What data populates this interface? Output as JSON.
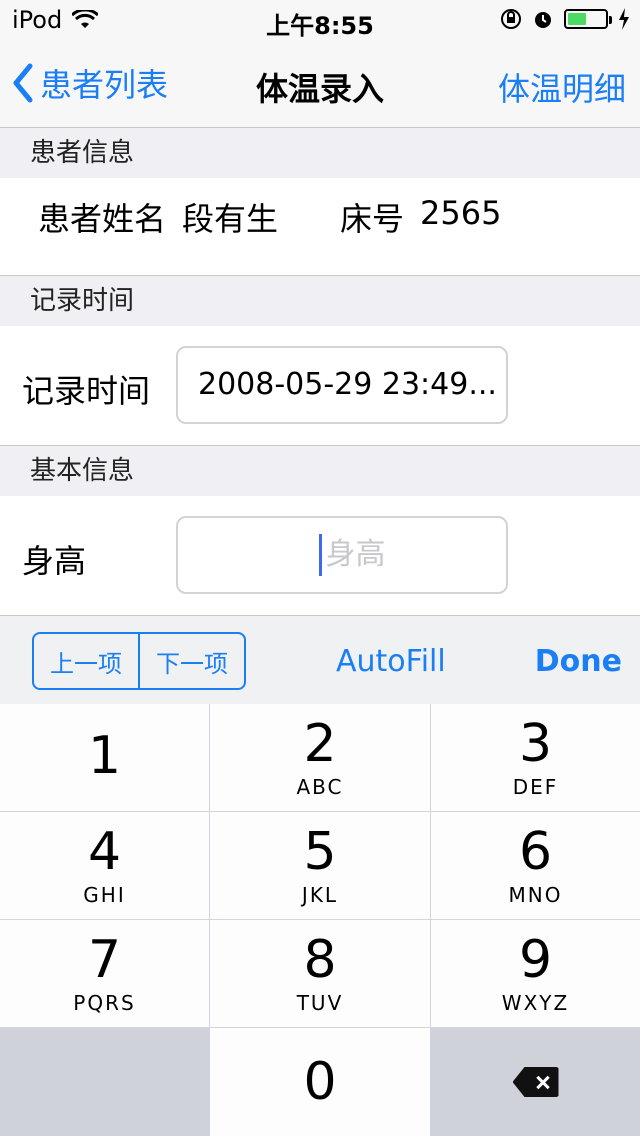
{
  "status_bar": {
    "device": "iPod",
    "time": "上午8:55"
  },
  "nav": {
    "back_label": "患者列表",
    "title": "体温录入",
    "right_label": "体温明细"
  },
  "sections": {
    "patient_header": "患者信息",
    "patient_name_label": "患者姓名",
    "patient_name": "段有生",
    "bed_label": "床号",
    "bed_number": "2565",
    "record_header": "记录时间",
    "record_time_label": "记录时间",
    "record_time_value": "2008-05-29 23:49...",
    "basic_header": "基本信息",
    "height_label": "身高",
    "height_placeholder": "身高"
  },
  "accessory_bar": {
    "prev_label": "上一项",
    "next_label": "下一项",
    "autofill_label": "AutoFill",
    "done_label": "Done"
  },
  "keypad": {
    "keys": [
      {
        "num": "1",
        "letters": ""
      },
      {
        "num": "2",
        "letters": "ABC"
      },
      {
        "num": "3",
        "letters": "DEF"
      },
      {
        "num": "4",
        "letters": "GHI"
      },
      {
        "num": "5",
        "letters": "JKL"
      },
      {
        "num": "6",
        "letters": "MNO"
      },
      {
        "num": "7",
        "letters": "PQRS"
      },
      {
        "num": "8",
        "letters": "TUV"
      },
      {
        "num": "9",
        "letters": "WXYZ"
      },
      {
        "num": "0",
        "letters": ""
      }
    ]
  },
  "colors": {
    "accent": "#1a7ef5",
    "battery": "#4cd964"
  }
}
